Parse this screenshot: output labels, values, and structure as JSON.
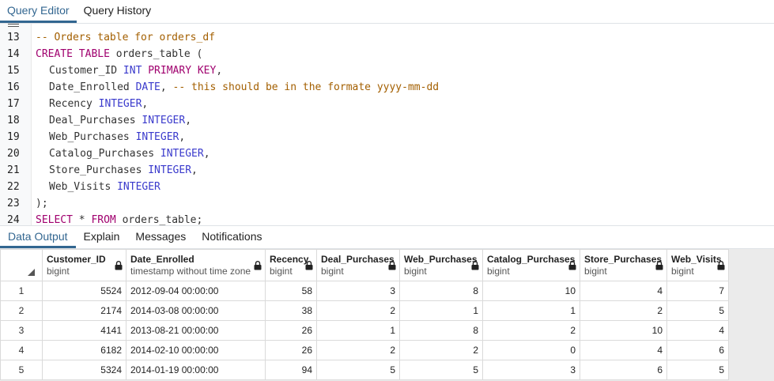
{
  "top_tabs": [
    {
      "label": "Query Editor",
      "active": true
    },
    {
      "label": "Query History",
      "active": false
    }
  ],
  "editor": {
    "lines": [
      {
        "num": "13",
        "tokens": [
          [
            "cm",
            "-- Orders table for orders_df"
          ]
        ]
      },
      {
        "num": "14",
        "tokens": [
          [
            "kw",
            "CREATE TABLE"
          ],
          [
            "id",
            " orders_table ("
          ]
        ]
      },
      {
        "num": "15",
        "indent": true,
        "tokens": [
          [
            "id",
            "Customer_ID "
          ],
          [
            "ty",
            "INT"
          ],
          [
            "id",
            " "
          ],
          [
            "kw",
            "PRIMARY KEY"
          ],
          [
            "id",
            ","
          ]
        ]
      },
      {
        "num": "16",
        "indent": true,
        "tokens": [
          [
            "id",
            "Date_Enrolled "
          ],
          [
            "ty",
            "DATE"
          ],
          [
            "id",
            ", "
          ],
          [
            "cm",
            "-- this should be in the formate yyyy-mm-dd"
          ]
        ]
      },
      {
        "num": "17",
        "indent": true,
        "tokens": [
          [
            "id",
            "Recency "
          ],
          [
            "ty",
            "INTEGER"
          ],
          [
            "id",
            ","
          ]
        ]
      },
      {
        "num": "18",
        "indent": true,
        "tokens": [
          [
            "id",
            "Deal_Purchases "
          ],
          [
            "ty",
            "INTEGER"
          ],
          [
            "id",
            ","
          ]
        ]
      },
      {
        "num": "19",
        "indent": true,
        "tokens": [
          [
            "id",
            "Web_Purchases "
          ],
          [
            "ty",
            "INTEGER"
          ],
          [
            "id",
            ","
          ]
        ]
      },
      {
        "num": "20",
        "indent": true,
        "tokens": [
          [
            "id",
            "Catalog_Purchases "
          ],
          [
            "ty",
            "INTEGER"
          ],
          [
            "id",
            ","
          ]
        ]
      },
      {
        "num": "21",
        "indent": true,
        "tokens": [
          [
            "id",
            "Store_Purchases "
          ],
          [
            "ty",
            "INTEGER"
          ],
          [
            "id",
            ","
          ]
        ]
      },
      {
        "num": "22",
        "indent": true,
        "tokens": [
          [
            "id",
            "Web_Visits "
          ],
          [
            "ty",
            "INTEGER"
          ]
        ]
      },
      {
        "num": "23",
        "tokens": [
          [
            "id",
            ");"
          ]
        ]
      },
      {
        "num": "24",
        "tokens": [
          [
            "kw",
            "SELECT"
          ],
          [
            "id",
            " * "
          ],
          [
            "kw",
            "FROM"
          ],
          [
            "id",
            " orders_table;"
          ]
        ]
      }
    ]
  },
  "bottom_tabs": [
    {
      "label": "Data Output",
      "active": true
    },
    {
      "label": "Explain",
      "active": false
    },
    {
      "label": "Messages",
      "active": false
    },
    {
      "label": "Notifications",
      "active": false
    }
  ],
  "grid": {
    "columns": [
      {
        "name": "Customer_ID",
        "type": "bigint",
        "align": "num"
      },
      {
        "name": "Date_Enrolled",
        "type": "timestamp without time zone",
        "align": "txt"
      },
      {
        "name": "Recency",
        "type": "bigint",
        "align": "num"
      },
      {
        "name": "Deal_Purchases",
        "type": "bigint",
        "align": "num"
      },
      {
        "name": "Web_Purchases",
        "type": "bigint",
        "align": "num"
      },
      {
        "name": "Catalog_Purchases",
        "type": "bigint",
        "align": "num"
      },
      {
        "name": "Store_Purchases",
        "type": "bigint",
        "align": "num"
      },
      {
        "name": "Web_Visits",
        "type": "bigint",
        "align": "num"
      }
    ],
    "rows": [
      {
        "num": "1",
        "cells": [
          "5524",
          "2012-09-04 00:00:00",
          "58",
          "3",
          "8",
          "10",
          "4",
          "7"
        ]
      },
      {
        "num": "2",
        "cells": [
          "2174",
          "2014-03-08 00:00:00",
          "38",
          "2",
          "1",
          "1",
          "2",
          "5"
        ]
      },
      {
        "num": "3",
        "cells": [
          "4141",
          "2013-08-21 00:00:00",
          "26",
          "1",
          "8",
          "2",
          "10",
          "4"
        ]
      },
      {
        "num": "4",
        "cells": [
          "6182",
          "2014-02-10 00:00:00",
          "26",
          "2",
          "2",
          "0",
          "4",
          "6"
        ]
      },
      {
        "num": "5",
        "cells": [
          "5324",
          "2014-01-19 00:00:00",
          "94",
          "5",
          "5",
          "3",
          "6",
          "5"
        ]
      }
    ]
  },
  "colors": {
    "accent": "#326690",
    "keyword": "#a0006e",
    "type": "#3a3acc",
    "comment": "#a35f00"
  },
  "icons": {
    "column_lock": "lock-icon",
    "select_all": "sort-corner-icon"
  }
}
